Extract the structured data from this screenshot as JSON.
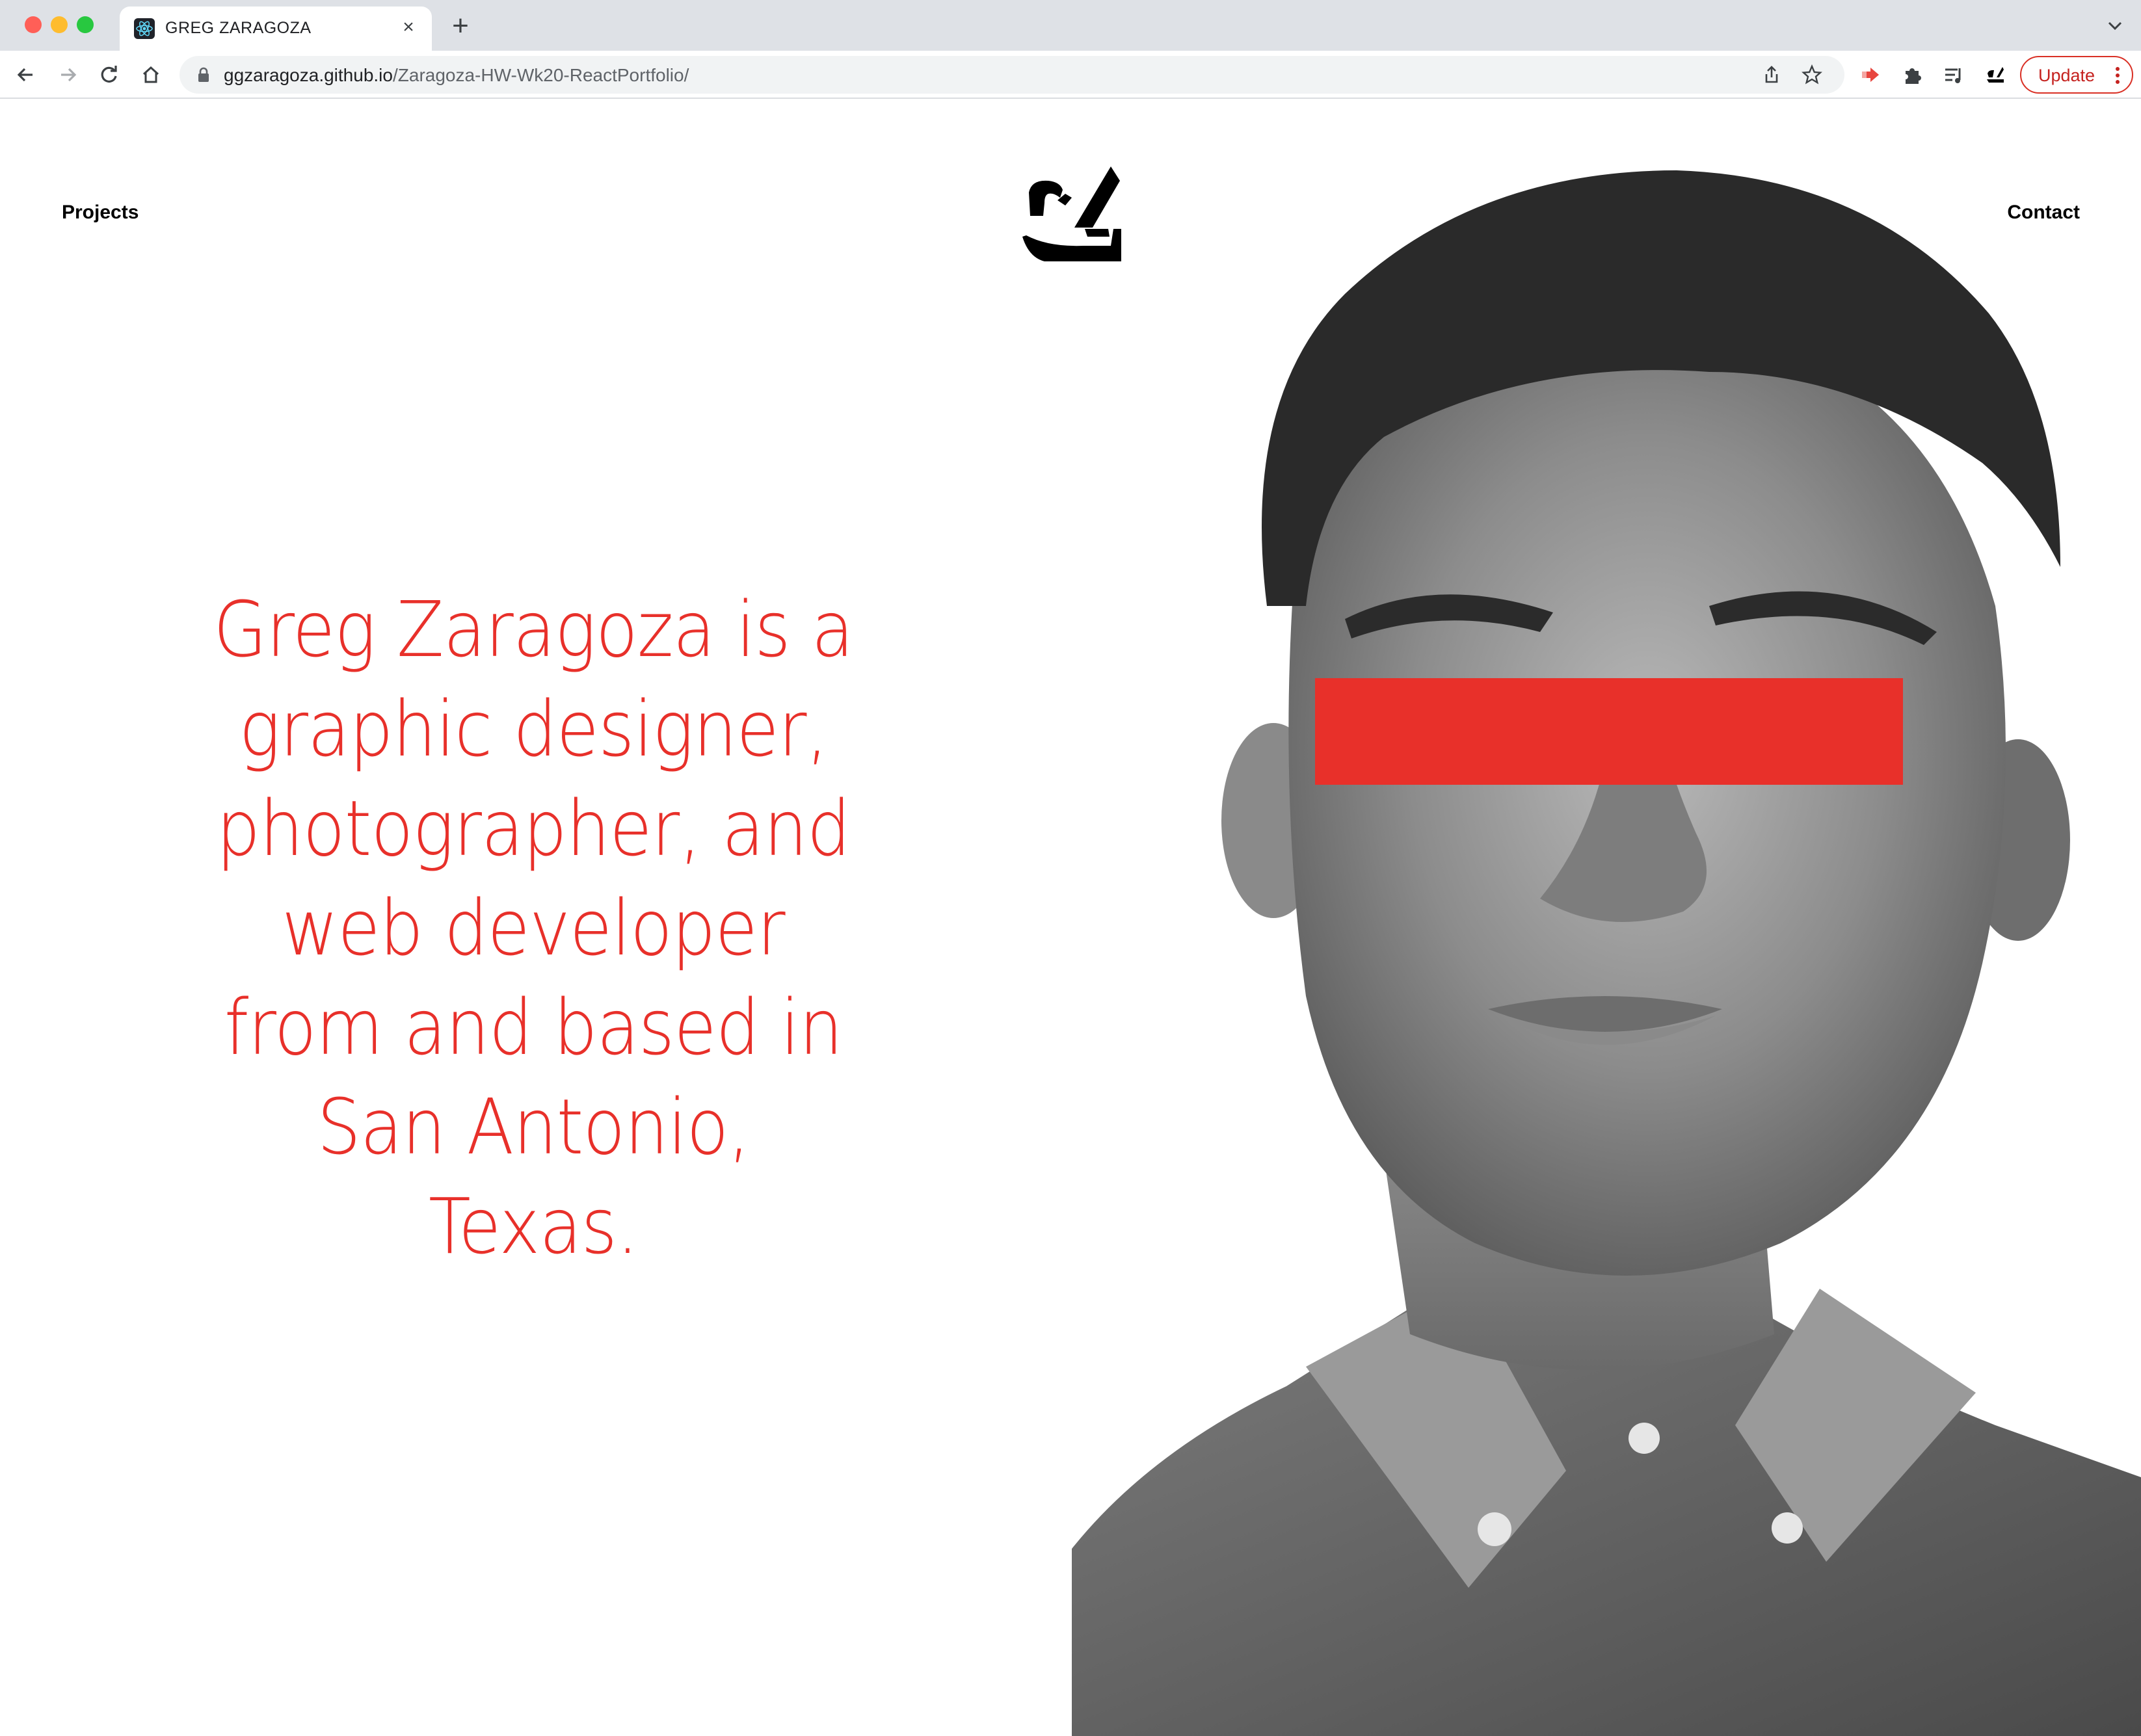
{
  "browser": {
    "tab_title": "GREG ZARAGOZA",
    "tab_close": "×",
    "new_tab": "+",
    "url_domain": "ggzaragoza.github.io",
    "url_path": "/Zaragoza-HW-Wk20-ReactPortfolio/",
    "update_label": "Update",
    "icons": [
      "back-icon",
      "forward-icon",
      "reload-icon",
      "home-icon",
      "lock-icon",
      "share-icon",
      "bookmark-star-icon",
      "extension-icon",
      "puzzle-icon",
      "reading-list-icon",
      "profile-logo-icon",
      "more-icon"
    ]
  },
  "site": {
    "nav_left": "Projects",
    "nav_right": "Contact",
    "hero_lines": [
      "Greg Zaragoza is a",
      "graphic designer,",
      "photographer, and",
      "web developer",
      "from and based in",
      "San Antonio,",
      "Texas."
    ],
    "accent_color": "#e8302a"
  }
}
